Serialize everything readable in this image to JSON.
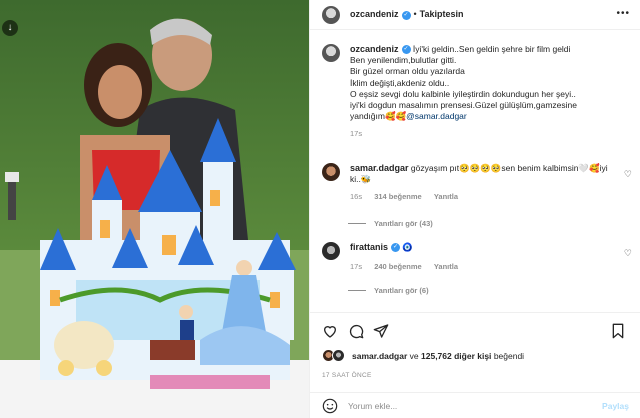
{
  "header": {
    "username": "ozcandeniz",
    "separator": "•",
    "follow_status": "Takiptesin",
    "more_icon": "more-horizontal-icon"
  },
  "caption": {
    "username": "ozcandeniz",
    "lines": [
      "İyi'ki geldin..Sen geldin şehre bir film geldi",
      "Ben yenilendim,bulutlar gitti.",
      "Bir güzel orman oldu yazılarda",
      "İklim değişti,akdeniz oldu..",
      "O eşsiz sevgi dolu kalbinle iyileştirdin dokundugun her şeyi..",
      "iyi'ki dogdun masalımın prensesi.Güzel gülüşlüm,gamzesine",
      "yandığım🥰🥰"
    ],
    "mention": "@samar.dadgar",
    "time": "17s"
  },
  "comments": [
    {
      "username": "samar.dadgar",
      "text_line1": "gözyaşım pıt🥺🥺🥺🥺sen benim kalbimsin🤍🥰iyi",
      "text_line2": "ki..🐝",
      "time": "16s",
      "likes": "314 beğenme",
      "reply": "Yanıtla",
      "view_replies": "Yanıtları gör (43)"
    },
    {
      "username": "firattanis",
      "text": "🧿",
      "time": "17s",
      "likes": "240 beğenme",
      "reply": "Yanıtla",
      "view_replies": "Yanıtları gör (6)"
    }
  ],
  "likes": {
    "first_user": "samar.dadgar",
    "middle": "ve",
    "count_text": "125,762 diğer kişi",
    "suffix": "beğendi"
  },
  "time_ago": "17 SAAT ÖNCE",
  "add_comment": {
    "placeholder": "Yorum ekle...",
    "post_label": "Paylaş"
  },
  "colors": {
    "link": "#00376b",
    "verified": "#3897f0",
    "muted": "#8e8e8e",
    "post_button": "#b2dffc"
  }
}
